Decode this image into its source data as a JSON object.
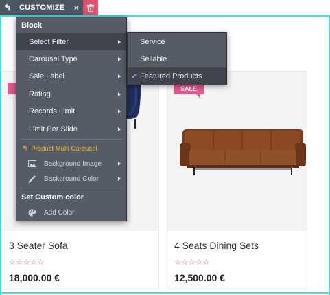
{
  "toolbar": {
    "parent_glyph": "↰",
    "label": "CUSTOMIZE",
    "close_glyph": "×"
  },
  "menu": {
    "header": "Block",
    "items": [
      {
        "label": "Select Filter"
      },
      {
        "label": "Carousel Type"
      },
      {
        "label": "Sale Label"
      },
      {
        "label": "Rating"
      },
      {
        "label": "Records Limit"
      },
      {
        "label": "Limit Per Slide"
      }
    ],
    "section_title": "Product Multi Carousel",
    "section_glyph": "↰",
    "sub_items": [
      {
        "label": "Background Image",
        "icon": "image-icon"
      },
      {
        "label": "Background Color",
        "icon": "eyedropper-icon"
      }
    ],
    "custom_color_header": "Set Custom color",
    "add_color": {
      "label": "Add Color",
      "icon": "palette-icon"
    }
  },
  "submenu": {
    "items": [
      {
        "label": "Service"
      },
      {
        "label": "Sellable"
      },
      {
        "label": "Featured Products",
        "checked": true
      }
    ],
    "check_glyph": "✔"
  },
  "products": [
    {
      "name": "3 Seater Sofa",
      "price": "18,000.00 €",
      "stars": "☆☆☆☆☆",
      "sale_label": ""
    },
    {
      "name": "4 Seats Dining Sets",
      "price": "12,500.00 €",
      "stars": "☆☆☆☆☆",
      "sale_label": "SALE"
    }
  ],
  "colors": {
    "accent_pink": "#e6578f",
    "selection_cyan": "#3ee0e6",
    "menu_bg": "#565c66",
    "delete_red": "#e2526f",
    "section_yellow": "#f2b630"
  }
}
